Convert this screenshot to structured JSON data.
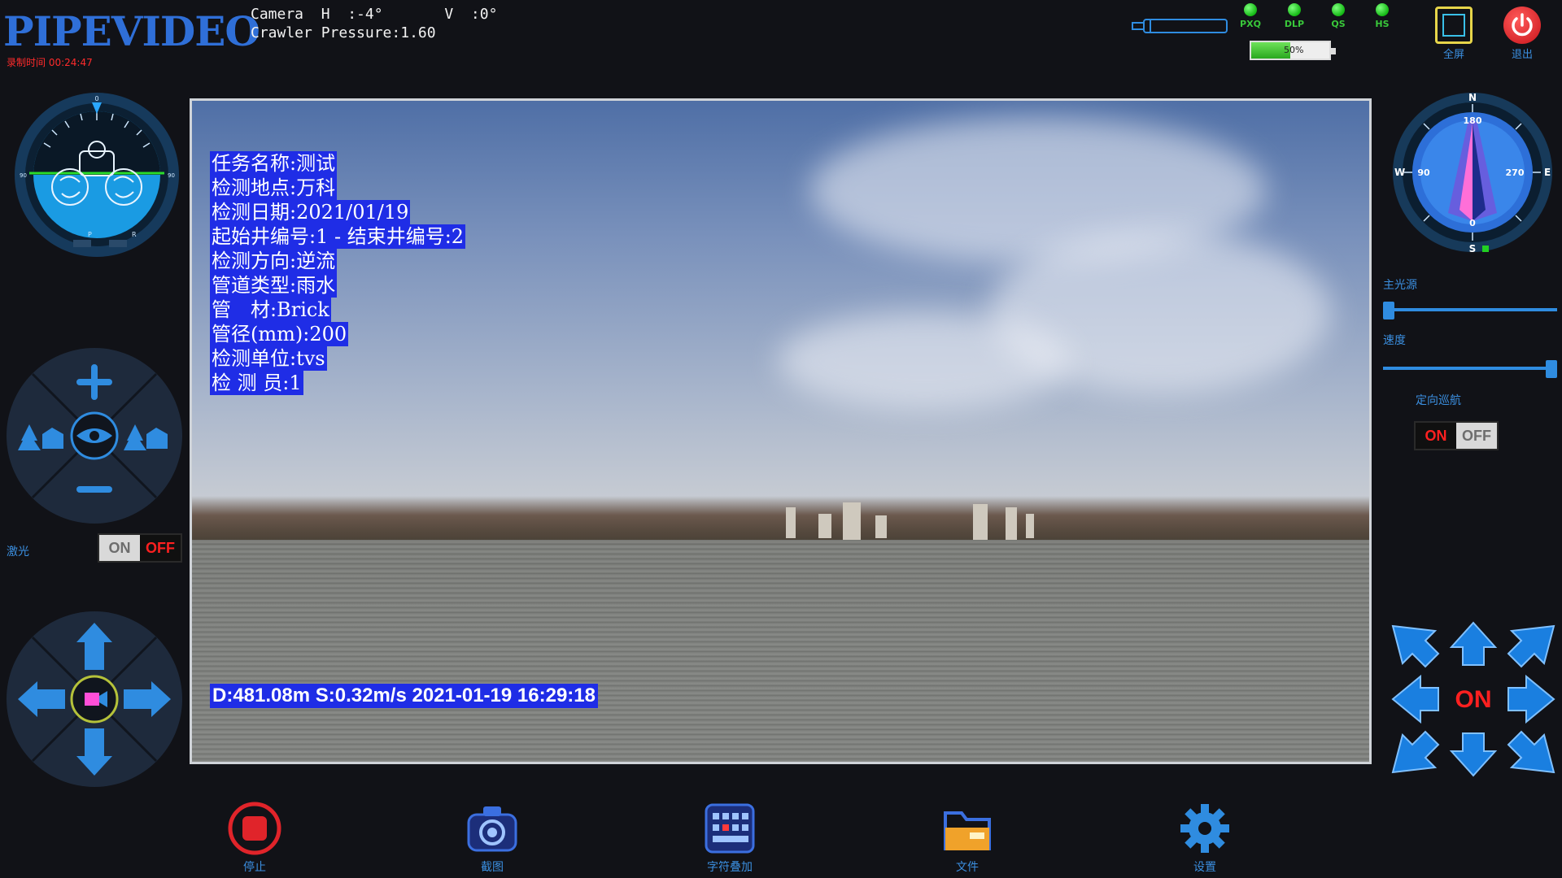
{
  "header": {
    "logo": "PIPEVIDEO",
    "recording_time": "录制时间 00:24:47",
    "camera_line": "Camera  H  :-4°       V  :0°",
    "pressure_line": "Crawler Pressure:1.60"
  },
  "status": {
    "leds": [
      {
        "label": "PXQ",
        "color": "#22c022"
      },
      {
        "label": "DLP",
        "color": "#22c022"
      },
      {
        "label": "QS",
        "color": "#22c022"
      },
      {
        "label": "HS",
        "color": "#22c022"
      }
    ],
    "battery": {
      "label": "50%",
      "level": 0.5
    }
  },
  "top_buttons": {
    "fullscreen": "全屏",
    "exit": "退出"
  },
  "osd": {
    "lines": [
      "任务名称:测试",
      "检测地点:万科",
      "检测日期:2021/01/19",
      "起始井编号:1 - 结束井编号:2",
      "检测方向:逆流",
      "管道类型:雨水",
      "管　材:Brick",
      "管径(mm):200",
      "检测单位:tvs",
      "检 测 员:1"
    ],
    "bottom": "D:481.08m S:0.32m/s  2021-01-19 16:29:18"
  },
  "left_gauge": {
    "top_mark": "0",
    "left_mark": "90",
    "right_mark": "90",
    "p_label": "P",
    "r_label": "R"
  },
  "laser": {
    "label": "激光",
    "on": "ON",
    "off": "OFF",
    "state": "off"
  },
  "compass": {
    "n": "N",
    "s": "S",
    "e": "E",
    "w": "W",
    "deg_top": "180",
    "deg_left": "90",
    "deg_right": "270",
    "deg_bottom": "0"
  },
  "sliders": [
    {
      "label": "主光源",
      "value": 0.0
    },
    {
      "label": "速度",
      "value": 1.0
    }
  ],
  "cruise": {
    "label": "定向巡航",
    "on": "ON",
    "off": "OFF",
    "state": "on"
  },
  "crawler": {
    "center_label": "ON"
  },
  "bottom_toolbar": {
    "stop": "停止",
    "capture": "截图",
    "overlay": "字符叠加",
    "files": "文件",
    "settings": "设置"
  },
  "colors": {
    "accent_blue": "#2f8ce0",
    "osd_blue": "#1f2de6",
    "alert_red": "#ff2020",
    "led_green": "#22c022"
  }
}
